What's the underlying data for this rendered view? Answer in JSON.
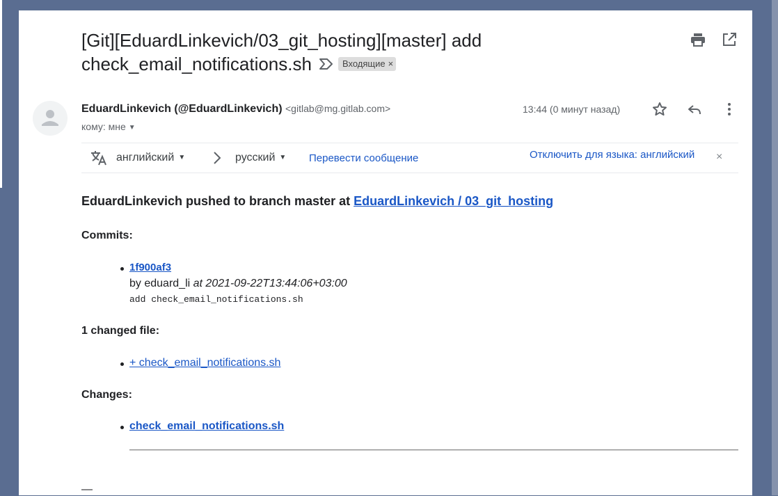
{
  "email": {
    "subject": "[Git][EduardLinkevich/03_git_hosting][master] add check_email_notifications.sh",
    "label": "Входящие",
    "label_close": "×",
    "sender_name": "EduardLinkevich (@EduardLinkevich)",
    "sender_email": "<gitlab@mg.gitlab.com>",
    "to_line": "кому: мне",
    "time": "13:44 (0 минут назад)"
  },
  "icons": [
    "print-icon",
    "open-in-new-window-icon",
    "importance-marker-icon",
    "avatar-person-icon",
    "star-icon",
    "reply-icon",
    "more-vert-icon",
    "translate-icon",
    "chevron-right-icon",
    "close-icon"
  ],
  "translate": {
    "source_lang": "английский",
    "target_lang": "русский",
    "translate_link": "Перевести сообщение",
    "disable_link": "Отключить для языка: английский",
    "close": "×"
  },
  "body": {
    "push_text": "EduardLinkevich pushed to branch master at ",
    "repo_link": "EduardLinkevich / 03_git_hosting",
    "commits_heading": "Commits:",
    "commit_id": "1f900af3",
    "commit_by": "by eduard_li ",
    "commit_at": "at 2021-09-22T13:44:06+03:00",
    "commit_message": "add check_email_notifications.sh",
    "changed_heading": "1 changed file:",
    "changed_file": "+ check_email_notifications.sh",
    "changes_heading": "Changes:",
    "changes_file": "check_email_notifications.sh",
    "signature": "—"
  },
  "colors": {
    "background": "#5a6d91",
    "link": "#1a57c6",
    "text": "#202124",
    "secondary_text": "#5f6368",
    "label_chip": "#dddddd"
  }
}
